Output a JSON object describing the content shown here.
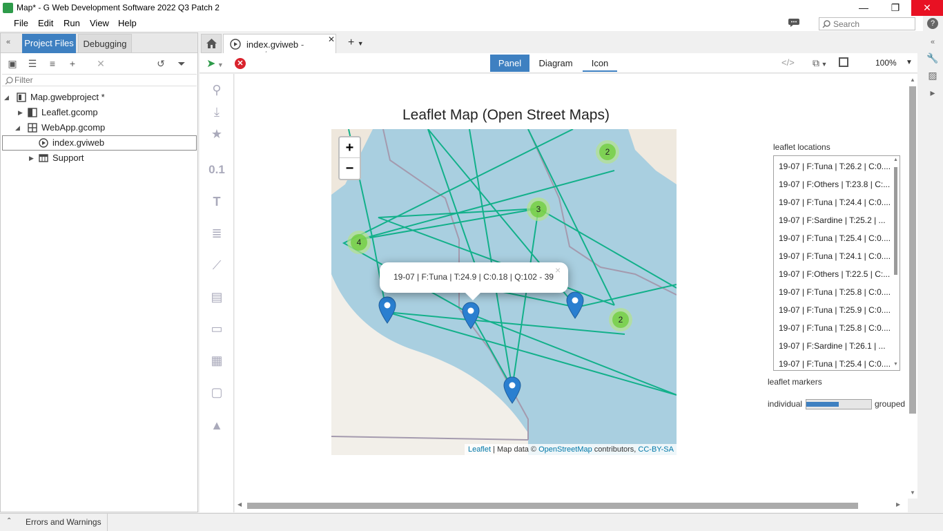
{
  "window": {
    "title": "Map* - G Web Development Software 2022 Q3 Patch 2",
    "minimize": "—",
    "restore": "❐",
    "close": "✕"
  },
  "menu": {
    "items": [
      "File",
      "Edit",
      "Run",
      "View",
      "Help"
    ],
    "search_placeholder": "Search"
  },
  "left_pane": {
    "tabs": [
      "Project Files",
      "Debugging"
    ],
    "filter_placeholder": "Filter",
    "tree": [
      {
        "label": "Map.gwebproject *"
      },
      {
        "label": "Leaflet.gcomp"
      },
      {
        "label": "WebApp.gcomp"
      },
      {
        "label": "index.gviweb"
      },
      {
        "label": "Support"
      }
    ]
  },
  "status": {
    "errors_label": "Errors and Warnings"
  },
  "editor": {
    "tab_name": "index.gviweb",
    "tab_status": "- running",
    "view_tabs": [
      "Panel",
      "Diagram",
      "Icon"
    ],
    "code_icon": "</>",
    "zoom": "100%"
  },
  "palette": {
    "numeric_label": "0.1"
  },
  "map": {
    "title": "Leaflet Map (Open Street Maps)",
    "zoom_in": "+",
    "zoom_out": "−",
    "clusters": [
      "2",
      "3",
      "4",
      "2"
    ],
    "popup_text": "19-07 | F:Tuna | T:24.9 | C:0.18 | Q:102 - 39",
    "popup_close": "×",
    "attribution": {
      "leaflet": "Leaflet",
      "sep": " | Map data © ",
      "osm": "OpenStreetMap",
      "contrib": " contributors, ",
      "license": "CC-BY-SA"
    }
  },
  "locations": {
    "label": "leaflet locations",
    "items": [
      "19-07 | F:Tuna | T:26.2 | C:0....",
      "19-07 | F:Others | T:23.8 | C:...",
      "19-07 | F:Tuna | T:24.4 | C:0....",
      "19-07 | F:Sardine | T:25.2 | ...",
      "19-07 | F:Tuna | T:25.4 | C:0....",
      "19-07 | F:Tuna | T:24.1 | C:0....",
      "19-07 | F:Others | T:22.5 | C:...",
      "19-07 | F:Tuna | T:25.8 | C:0....",
      "19-07 | F:Tuna | T:25.9 | C:0....",
      "19-07 | F:Tuna | T:25.8 | C:0....",
      "19-07 | F:Sardine | T:26.1 | ...",
      "19-07 | F:Tuna | T:25.4 | C:0...."
    ]
  },
  "markers": {
    "label": "leaflet markers",
    "left": "individual",
    "right": "grouped",
    "value": 0.5
  },
  "colors": {
    "accent": "#3e80c1",
    "route": "#12b08a",
    "water": "#a9cfe0",
    "marker": "#2a7fd0"
  }
}
